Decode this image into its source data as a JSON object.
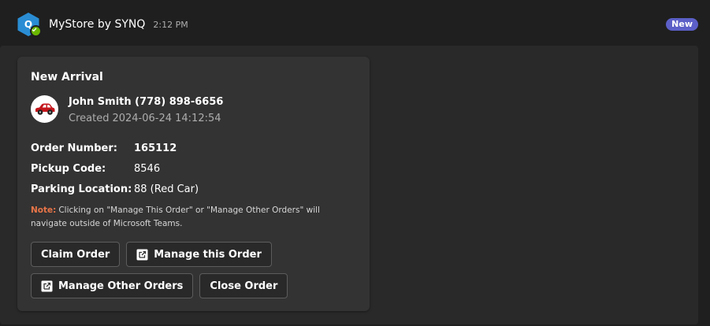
{
  "header": {
    "app_initial": "Q",
    "app_name": "MyStore by SYNQ",
    "time": "2:12 PM",
    "badge": "New",
    "avatar_icon": "hexagon-app-icon",
    "status_icon": "available-check-icon"
  },
  "card": {
    "title": "New Arrival",
    "customer": {
      "icon": "red-car-icon",
      "name": "John Smith (778) 898-6656",
      "created_label": "Created",
      "created_value": "2024-06-24 14:12:54"
    },
    "facts": [
      {
        "key": "Order Number:",
        "value": "165112"
      },
      {
        "key": "Pickup Code:",
        "value": "8546"
      },
      {
        "key": "Parking Location:",
        "value": "88 (Red Car)"
      }
    ],
    "note": {
      "label": "Note:",
      "text": "Clicking on \"Manage This Order\" or \"Manage Other Orders\" will navigate outside of Microsoft Teams."
    },
    "actions": {
      "claim_order": "Claim Order",
      "manage_this_order": "Manage this Order",
      "manage_other_orders": "Manage Other Orders",
      "close_order": "Close Order",
      "external_icon": "open-external-icon"
    }
  },
  "colors": {
    "page_bg": "#1f1f1f",
    "card_bg": "#333333",
    "badge_bg": "#5b5fc7",
    "avatar_blue": "#2a8dd4",
    "status_green": "#6bb700",
    "note_label": "#e97548",
    "car_red": "#c4161c"
  }
}
